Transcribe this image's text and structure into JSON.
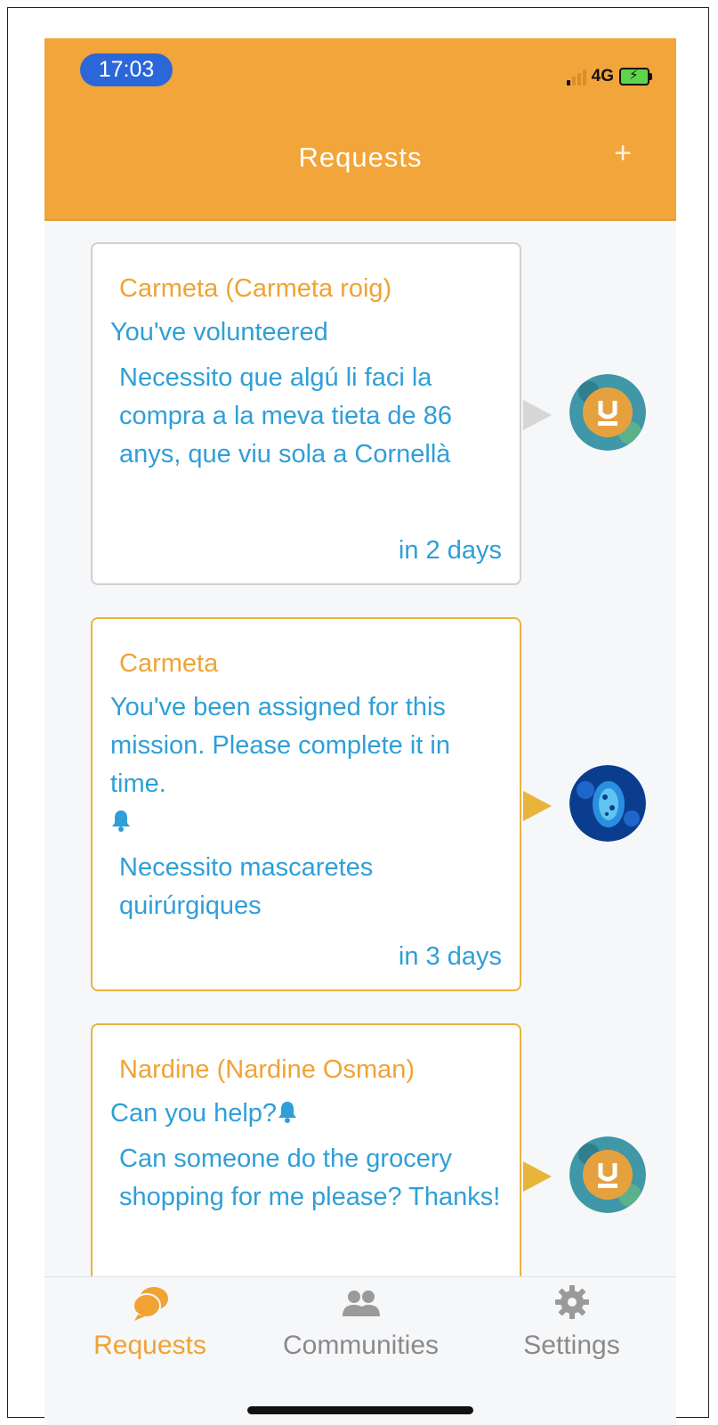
{
  "status_bar": {
    "time": "17:03",
    "network": "4G"
  },
  "header": {
    "title": "Requests",
    "add_label": "+"
  },
  "requests": [
    {
      "name": "Carmeta (Carmeta roig)",
      "status": "You've volunteered",
      "description": "Necessito que algú li faci la compra a la meva tieta de 86 anys, que viu sola a Cornellà",
      "due": "in 2 days",
      "border": "gray"
    },
    {
      "name": "Carmeta",
      "status": "You've been assigned for this mission. Please complete it in time.",
      "description": "Necessito mascaretes quirúrgiques",
      "due": "in 3 days",
      "border": "gold"
    },
    {
      "name": "Nardine (Nardine Osman)",
      "status": "Can you help?",
      "description": "Can someone do the grocery shopping for me please? Thanks!",
      "due": "",
      "border": "gold"
    }
  ],
  "tabs": [
    {
      "label": "Requests",
      "icon": "chat-bubbles-icon",
      "active": true
    },
    {
      "label": "Communities",
      "icon": "people-icon",
      "active": false
    },
    {
      "label": "Settings",
      "icon": "gear-icon",
      "active": false
    }
  ],
  "colors": {
    "header_bg": "#f2a53a",
    "accent_orange": "#f0a334",
    "text_blue": "#2f9fd8",
    "card_gold_border": "#e8b43a"
  }
}
